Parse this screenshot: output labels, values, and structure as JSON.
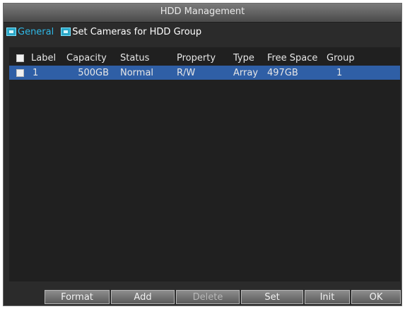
{
  "window": {
    "title": "HDD Management"
  },
  "tabs": [
    {
      "label": "General",
      "active": true
    },
    {
      "label": "Set Cameras for HDD Group",
      "active": false
    }
  ],
  "table": {
    "columns": [
      "Label",
      "Capacity",
      "Status",
      "Property",
      "Type",
      "Free Space",
      "Group"
    ],
    "rows": [
      {
        "label": "1",
        "capacity": "500GB",
        "status": "Normal",
        "property": "R/W",
        "type": "Array",
        "free_space": "497GB",
        "group": "1"
      }
    ]
  },
  "buttons": {
    "format": "Format",
    "add": "Add",
    "delete": "Delete",
    "set": "Set",
    "init": "Init",
    "ok": "OK"
  },
  "colors": {
    "selection": "#2f5fa6",
    "active_tab": "#2fb8e6",
    "window_bg": "#2b2b2b"
  }
}
